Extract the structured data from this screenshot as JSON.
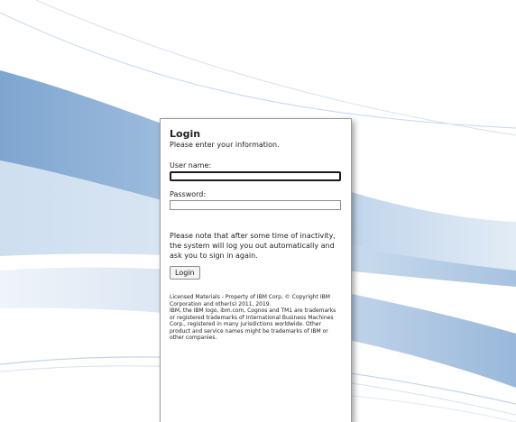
{
  "login": {
    "title": "Login",
    "subtitle": "Please enter your information.",
    "username_label": "User name:",
    "username_value": "",
    "password_label": "Password:",
    "password_value": "",
    "notice": "Please note that after some time of inactivity, the system will log you out automatically and ask you to sign in again.",
    "login_button": "Login"
  },
  "legal": {
    "line1": "Licensed Materials - Property of IBM Corp. © Copyright IBM Corporation and other(s) 2011, 2019.",
    "line2": "IBM, the IBM logo, ibm.com, Cognos and TM1 are trademarks or registered trademarks of International Business Machines Corp., registered in many jurisdictions worldwide. Other product and service names might be trademarks of IBM or other companies."
  },
  "colors": {
    "wave_dark": "#8fb2d6",
    "wave_mid": "#b7cfe7",
    "wave_light": "#dce8f4",
    "panel_border": "#9a9a9a"
  }
}
